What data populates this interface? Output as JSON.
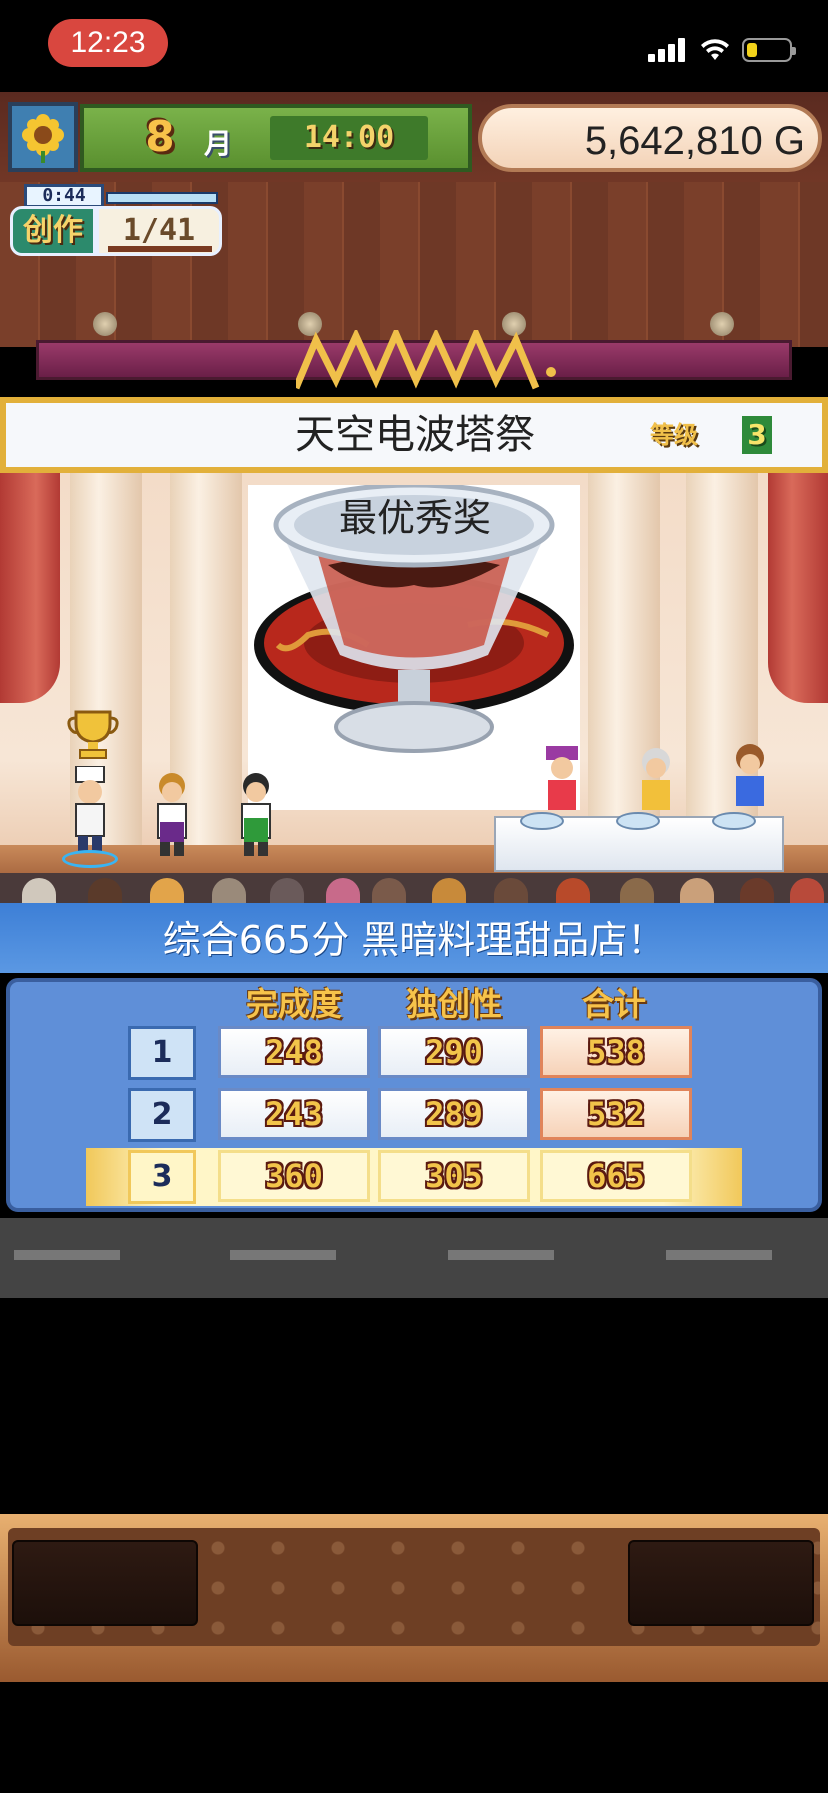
{
  "status_bar": {
    "time": "12:23",
    "wifi_icon": "wifi-icon",
    "battery_icon": "battery-low-icon"
  },
  "hud": {
    "emblem_icon": "sunflower-icon",
    "month": "8",
    "month_label": "月",
    "time": "14:00",
    "money": "5,642,810 G",
    "create_timer": "0:44",
    "create_label": "创作",
    "create_count": "1/41"
  },
  "event": {
    "title": "天空电波塔祭",
    "level_label": "等级",
    "level": "3",
    "award": "最优秀奖"
  },
  "result": {
    "summary": "综合665分 黑暗料理甜品店！",
    "columns": [
      "完成度",
      "独创性",
      "合计"
    ],
    "rows": [
      {
        "rank": "1",
        "completion": "248",
        "originality": "290",
        "total": "538"
      },
      {
        "rank": "2",
        "completion": "243",
        "originality": "289",
        "total": "532"
      },
      {
        "rank": "3",
        "completion": "360",
        "originality": "305",
        "total": "665"
      }
    ]
  },
  "colors": {
    "banner_border": "#e2b03a",
    "result_header": "#3d7fd6",
    "score_board": "#5f8fd8",
    "score_text": "#f2c44a",
    "clock_pill": "#d9473f"
  }
}
